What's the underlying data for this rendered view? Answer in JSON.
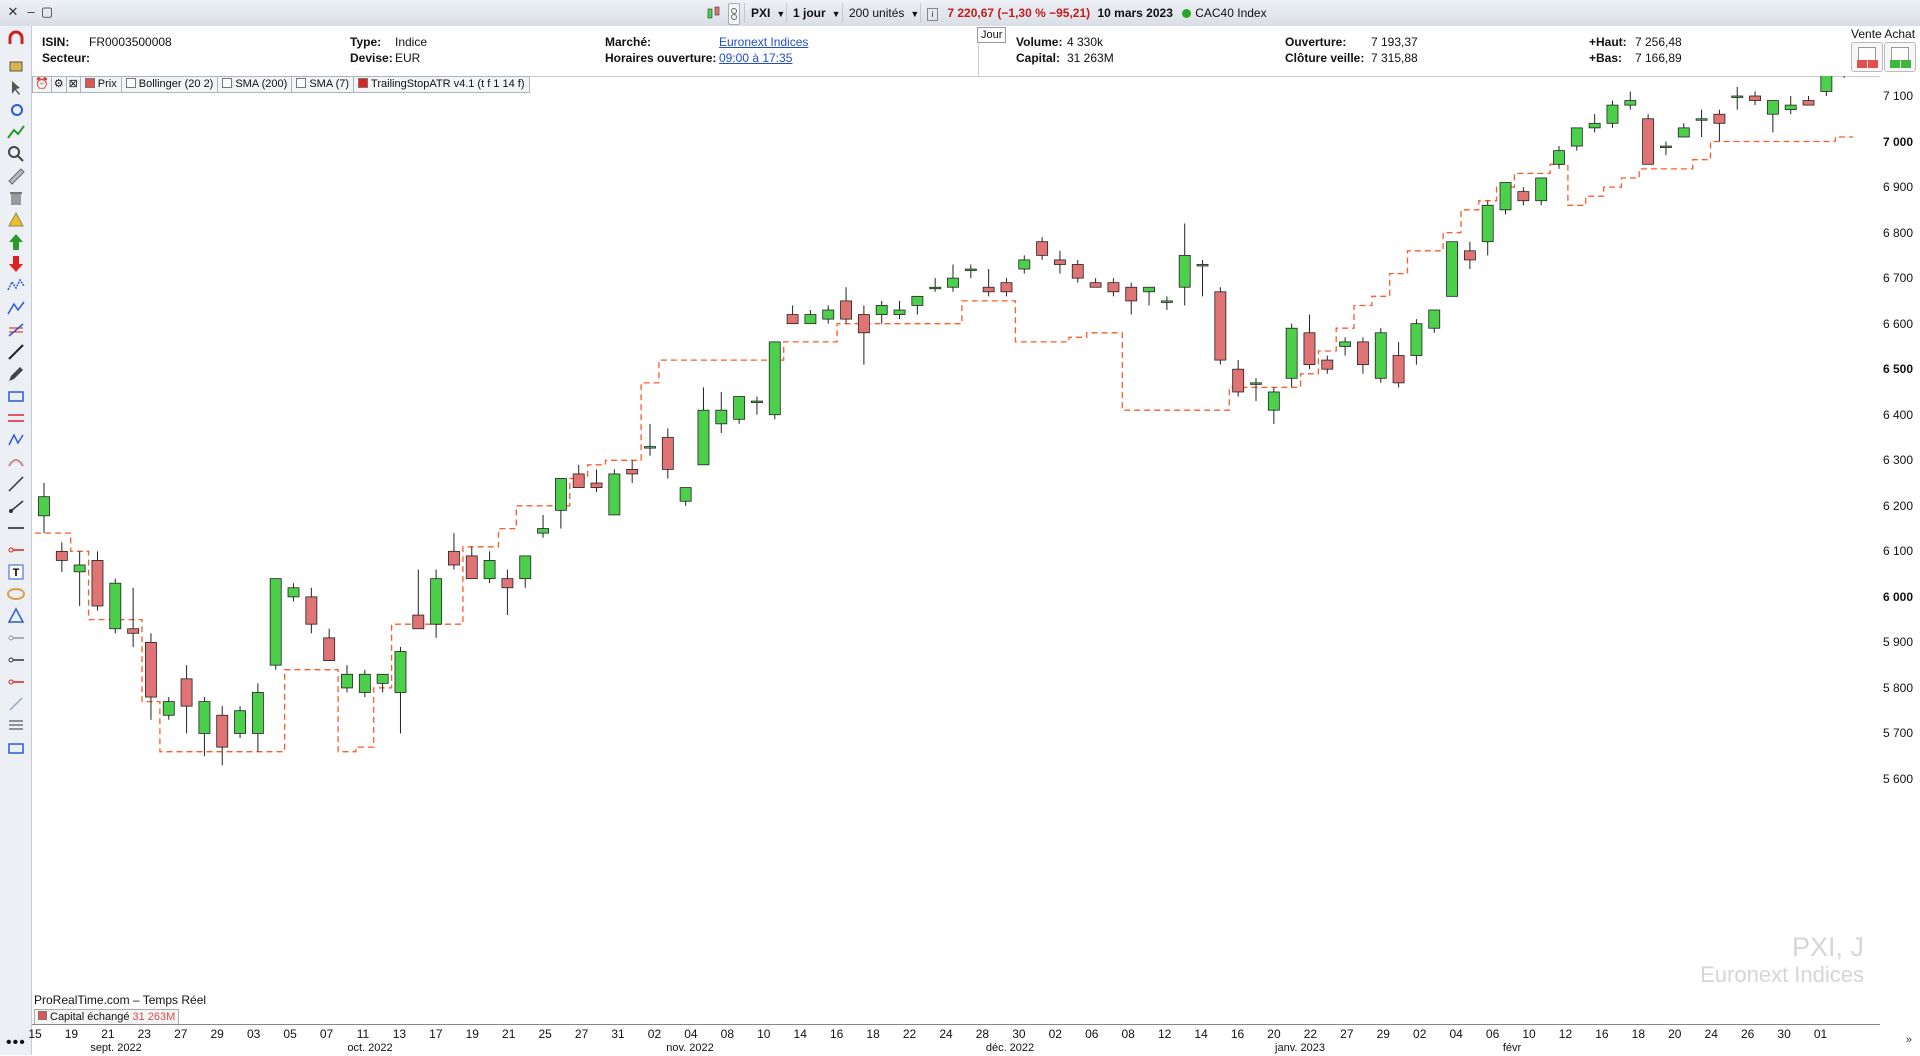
{
  "window": {
    "symbol": "PXI",
    "timeframe": "1 jour",
    "units": "200 unités",
    "quote": "7 220,67 (−1,30 % −95,21)",
    "date": "10 mars 2023",
    "index_name": "CAC40 Index"
  },
  "info": {
    "isin_label": "ISIN:",
    "isin": "FR0003500008",
    "secteur_label": "Secteur:",
    "type_label": "Type:",
    "type": "Indice",
    "devise_label": "Devise:",
    "devise": "EUR",
    "marche_label": "Marché:",
    "marche": "Euronext Indices",
    "horaires_label": "Horaires ouverture:",
    "horaires": "09:00 à 17:35",
    "tab": "Jour",
    "volume_label": "Volume:",
    "volume": "4 330k",
    "capital_label": "Capital:",
    "capital": "31 263M",
    "ouverture_label": "Ouverture:",
    "ouverture": "7 193,37",
    "cloture_label": "Clôture veille:",
    "cloture": "7 315,88",
    "haut_label": "+Haut:",
    "haut": "7 256,48",
    "bas_label": "+Bas:",
    "bas": "7 166,89",
    "trade_title": "Vente Achat"
  },
  "indicators": [
    "Prix",
    "Bollinger (20 2)",
    "SMA (200)",
    "SMA (7)",
    "TrailingStopATR v4.1 (t f 1 14 f)"
  ],
  "footer": {
    "source": "ProRealTime.com – Temps Réel",
    "capital_label": "Capital échangé",
    "capital_value": "31 263M",
    "watermark_symbol": "PXI, J",
    "watermark_market": "Euronext Indices"
  },
  "colors": {
    "up": "#4cd04c",
    "down": "#e07474",
    "stop": "#ff5a2a",
    "link": "#1f4fc9"
  },
  "chart_data": {
    "type": "candlestick",
    "y_ticks": [
      5600,
      5700,
      5800,
      5900,
      6000,
      6100,
      6200,
      6300,
      6400,
      6500,
      6600,
      6700,
      6800,
      6900,
      7000,
      7100
    ],
    "y_tick_labels": [
      "5 600",
      "5 700",
      "5 800",
      "5 900",
      "6 000",
      "6 100",
      "6 200",
      "6 300",
      "6 400",
      "6 500",
      "6 600",
      "6 700",
      "6 800",
      "6 900",
      "7 000",
      "7 100"
    ],
    "y_bold": [
      6000,
      6500,
      7000
    ],
    "x_ticks": [
      "15",
      "19",
      "21",
      "23",
      "27",
      "29",
      "03",
      "05",
      "07",
      "11",
      "13",
      "17",
      "19",
      "21",
      "25",
      "27",
      "31",
      "02",
      "04",
      "08",
      "10",
      "14",
      "16",
      "18",
      "22",
      "24",
      "28",
      "30",
      "02",
      "06",
      "08",
      "12",
      "14",
      "16",
      "20",
      "22",
      "27",
      "29",
      "02",
      "04",
      "06",
      "10",
      "12",
      "16",
      "18",
      "20",
      "24",
      "26",
      "30",
      "01"
    ],
    "months": [
      "sept. 2022",
      "oct. 2022",
      "nov. 2022",
      "déc. 2022",
      "janv. 2023",
      "févr"
    ],
    "ohlc": [
      [
        6178,
        6250,
        6140,
        6220
      ],
      [
        6100,
        6120,
        6055,
        6080
      ],
      [
        6055,
        6100,
        5980,
        6070
      ],
      [
        6080,
        6100,
        5970,
        5980
      ],
      [
        5930,
        6040,
        5920,
        6030
      ],
      [
        5930,
        6020,
        5890,
        5920
      ],
      [
        5900,
        5920,
        5730,
        5780
      ],
      [
        5740,
        5780,
        5730,
        5770
      ],
      [
        5820,
        5850,
        5700,
        5760
      ],
      [
        5700,
        5780,
        5650,
        5770
      ],
      [
        5740,
        5760,
        5630,
        5670
      ],
      [
        5700,
        5760,
        5690,
        5750
      ],
      [
        5700,
        5810,
        5660,
        5790
      ],
      [
        5850,
        6040,
        5840,
        6040
      ],
      [
        6000,
        6030,
        5990,
        6020
      ],
      [
        6000,
        6020,
        5920,
        5940
      ],
      [
        5910,
        5930,
        5860,
        5860
      ],
      [
        5800,
        5850,
        5790,
        5830
      ],
      [
        5790,
        5840,
        5780,
        5830
      ],
      [
        5810,
        5830,
        5790,
        5830
      ],
      [
        5790,
        5890,
        5700,
        5880
      ],
      [
        5960,
        6060,
        5940,
        5930
      ],
      [
        5940,
        6060,
        5910,
        6040
      ],
      [
        6100,
        6140,
        6060,
        6070
      ],
      [
        6090,
        6110,
        6040,
        6040
      ],
      [
        6040,
        6100,
        6030,
        6080
      ],
      [
        6040,
        6060,
        5960,
        6020
      ],
      [
        6040,
        6090,
        6020,
        6090
      ],
      [
        6140,
        6180,
        6130,
        6150
      ],
      [
        6190,
        6250,
        6150,
        6260
      ],
      [
        6270,
        6290,
        6240,
        6240
      ],
      [
        6250,
        6280,
        6230,
        6240
      ],
      [
        6180,
        6280,
        6180,
        6270
      ],
      [
        6280,
        6300,
        6250,
        6270
      ],
      [
        6330,
        6380,
        6310,
        6330
      ],
      [
        6350,
        6370,
        6260,
        6280
      ],
      [
        6210,
        6240,
        6200,
        6240
      ],
      [
        6290,
        6460,
        6290,
        6410
      ],
      [
        6380,
        6450,
        6360,
        6410
      ],
      [
        6390,
        6440,
        6380,
        6440
      ],
      [
        6430,
        6440,
        6400,
        6430
      ],
      [
        6400,
        6560,
        6390,
        6560
      ],
      [
        6620,
        6640,
        6600,
        6600
      ],
      [
        6600,
        6630,
        6600,
        6620
      ],
      [
        6610,
        6640,
        6600,
        6630
      ],
      [
        6650,
        6680,
        6600,
        6610
      ],
      [
        6620,
        6640,
        6510,
        6580
      ],
      [
        6620,
        6650,
        6600,
        6640
      ],
      [
        6620,
        6650,
        6610,
        6630
      ],
      [
        6640,
        6660,
        6620,
        6660
      ],
      [
        6680,
        6700,
        6670,
        6680
      ],
      [
        6680,
        6730,
        6670,
        6700
      ],
      [
        6720,
        6730,
        6700,
        6720
      ],
      [
        6680,
        6720,
        6660,
        6670
      ],
      [
        6690,
        6700,
        6660,
        6670
      ],
      [
        6720,
        6750,
        6710,
        6740
      ],
      [
        6780,
        6790,
        6740,
        6750
      ],
      [
        6740,
        6760,
        6710,
        6730
      ],
      [
        6730,
        6740,
        6690,
        6700
      ],
      [
        6690,
        6700,
        6680,
        6680
      ],
      [
        6690,
        6700,
        6660,
        6670
      ],
      [
        6680,
        6690,
        6620,
        6650
      ],
      [
        6670,
        6680,
        6640,
        6680
      ],
      [
        6650,
        6660,
        6630,
        6650
      ],
      [
        6680,
        6820,
        6640,
        6750
      ],
      [
        6730,
        6740,
        6660,
        6730
      ],
      [
        6670,
        6680,
        6510,
        6520
      ],
      [
        6500,
        6520,
        6440,
        6450
      ],
      [
        6470,
        6480,
        6430,
        6470
      ],
      [
        6410,
        6460,
        6380,
        6450
      ],
      [
        6480,
        6600,
        6460,
        6590
      ],
      [
        6580,
        6620,
        6500,
        6510
      ],
      [
        6520,
        6530,
        6490,
        6500
      ],
      [
        6550,
        6570,
        6530,
        6560
      ],
      [
        6560,
        6570,
        6490,
        6510
      ],
      [
        6480,
        6590,
        6470,
        6580
      ],
      [
        6530,
        6560,
        6460,
        6470
      ],
      [
        6530,
        6610,
        6510,
        6600
      ],
      [
        6590,
        6630,
        6580,
        6630
      ],
      [
        6660,
        6740,
        6660,
        6780
      ],
      [
        6760,
        6780,
        6720,
        6740
      ],
      [
        6780,
        6870,
        6750,
        6860
      ],
      [
        6850,
        6900,
        6840,
        6910
      ],
      [
        6890,
        6900,
        6860,
        6870
      ],
      [
        6870,
        6920,
        6860,
        6920
      ],
      [
        6950,
        6990,
        6940,
        6980
      ],
      [
        6990,
        7030,
        6980,
        7030
      ],
      [
        7030,
        7060,
        7020,
        7040
      ],
      [
        7040,
        7090,
        7030,
        7080
      ],
      [
        7080,
        7110,
        7070,
        7090
      ],
      [
        7050,
        7060,
        6950,
        6950
      ],
      [
        6990,
        7000,
        6970,
        6990
      ],
      [
        7010,
        7040,
        7010,
        7030
      ],
      [
        7050,
        7070,
        7010,
        7050
      ],
      [
        7060,
        7070,
        7000,
        7040
      ],
      [
        7100,
        7120,
        7070,
        7100
      ],
      [
        7100,
        7110,
        7080,
        7090
      ],
      [
        7060,
        7090,
        7020,
        7090
      ],
      [
        7070,
        7100,
        7060,
        7080
      ],
      [
        7090,
        7100,
        7080,
        7080
      ],
      [
        7110,
        7170,
        7100,
        7170
      ],
      [
        7170,
        7230,
        7140,
        7220
      ]
    ],
    "trailing_stop": [
      6140,
      6140,
      6100,
      5950,
      5950,
      5950,
      5770,
      5660,
      5660,
      5660,
      5660,
      5660,
      5660,
      5660,
      5840,
      5840,
      5840,
      5660,
      5670,
      5800,
      5940,
      5940,
      5940,
      5940,
      6110,
      6110,
      6150,
      6200,
      6200,
      6200,
      6260,
      6290,
      6300,
      6300,
      6470,
      6520,
      6520,
      6520,
      6520,
      6520,
      6520,
      6520,
      6560,
      6560,
      6560,
      6600,
      6600,
      6600,
      6600,
      6600,
      6600,
      6600,
      6650,
      6650,
      6650,
      6560,
      6560,
      6560,
      6570,
      6580,
      6580,
      6410,
      6410,
      6410,
      6410,
      6410,
      6410,
      6460,
      6460,
      6460,
      6460,
      6490,
      6540,
      6590,
      6640,
      6660,
      6710,
      6760,
      6760,
      6800,
      6850,
      6870,
      6900,
      6930,
      6930,
      6950,
      6860,
      6880,
      6900,
      6920,
      6940,
      6940,
      6940,
      6960,
      7000,
      7000,
      7000,
      7000,
      7000,
      7000,
      7000,
      7010
    ]
  }
}
